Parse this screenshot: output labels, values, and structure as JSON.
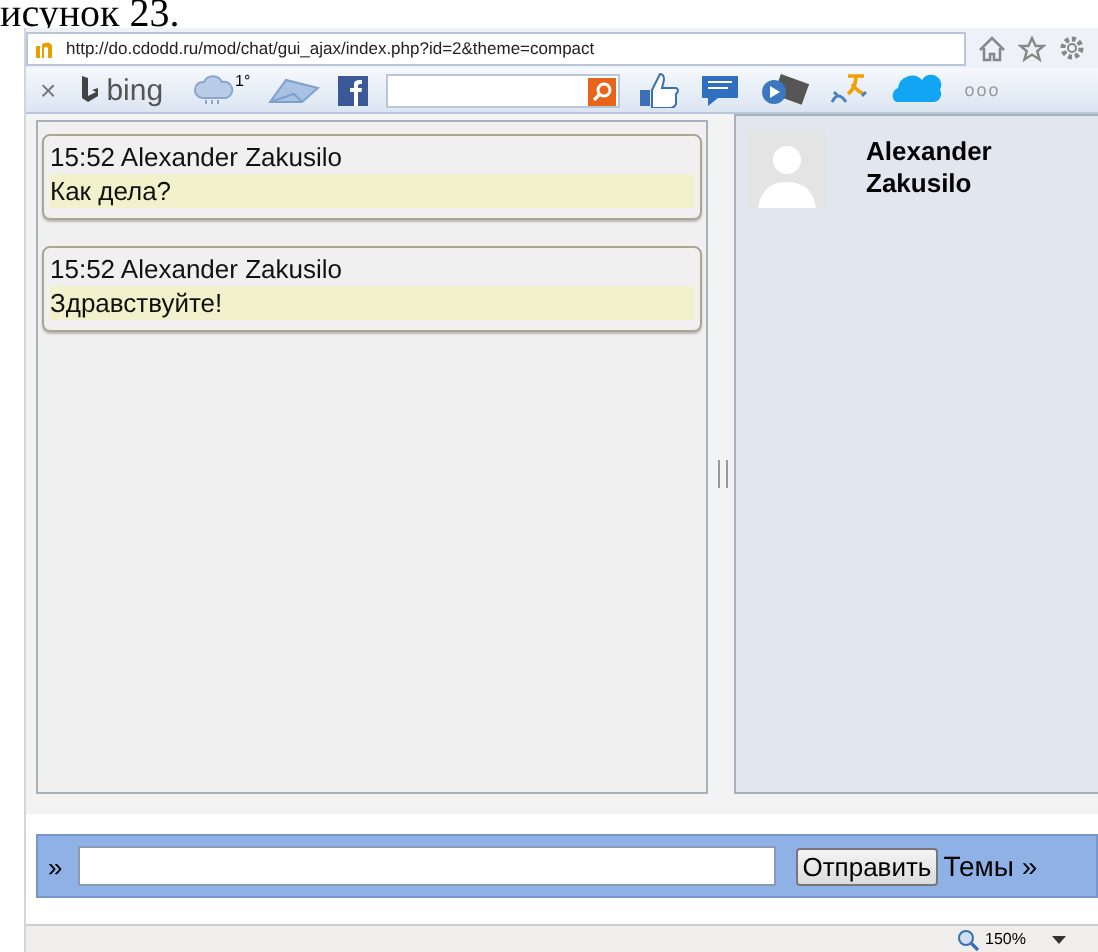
{
  "caption": "исунок 23.",
  "address_bar": {
    "url": "http://do.cdodd.ru/mod/chat/gui_ajax/index.php?id=2&theme=compact"
  },
  "toolbar": {
    "close": "×",
    "bing": "bing",
    "weather": "1°",
    "more": "ooo"
  },
  "messages": [
    {
      "time": "15:52",
      "author": "Alexander Zakusilo",
      "text": "Как дела?"
    },
    {
      "time": "15:52",
      "author": "Alexander Zakusilo",
      "text": "Здравствуйте!"
    }
  ],
  "users": [
    {
      "name": "Alexander Zakusilo"
    }
  ],
  "input_bar": {
    "prompt": "»",
    "send": "Отправить",
    "themes": "Темы »"
  },
  "status_bar": {
    "zoom": "150%"
  }
}
